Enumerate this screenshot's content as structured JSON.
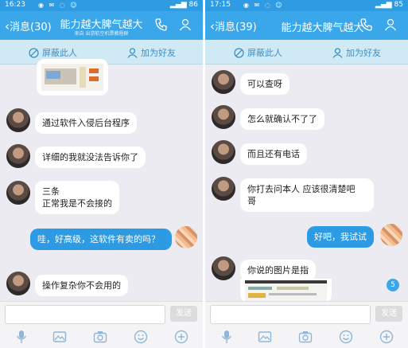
{
  "left": {
    "status": {
      "time": "16:23",
      "battery": "86"
    },
    "nav": {
      "back": "消息(30)",
      "title": "能力越大脾气越大",
      "subtitle": "来自 出游航空机票教程群"
    },
    "actions": {
      "block": "屏蔽此人",
      "add": "加为好友"
    },
    "messages": [
      {
        "text": "通过软件入侵后台程序"
      },
      {
        "text": "详细的我就没法告诉你了"
      },
      {
        "text": "三条\n正常我是不会接的"
      },
      {
        "text": "哇，好高级，这软件有卖的吗？"
      },
      {
        "text": "操作复杂你不会用的"
      }
    ],
    "send": "发送"
  },
  "right": {
    "status": {
      "time": "17:15",
      "battery": "85"
    },
    "nav": {
      "back": "消息(39)",
      "title": "能力越大脾气越大"
    },
    "actions": {
      "block": "屏蔽此人",
      "add": "加为好友"
    },
    "messages": [
      {
        "text": "可以查呀"
      },
      {
        "text": "怎么就确认不了了"
      },
      {
        "text": "而且还有电话"
      },
      {
        "text": "你打去问本人  应该很清楚吧\n哥"
      },
      {
        "text": "好吧，我试试"
      },
      {
        "text": "你说的图片是指"
      }
    ],
    "badge": "5",
    "send": "发送"
  },
  "colors": {
    "status": "#2e9be2",
    "nav": "#3aa7ea",
    "actionbar": "#cfeaf5",
    "chat_bg": "#ebebf1",
    "my_bubble": "#2c9be4"
  }
}
